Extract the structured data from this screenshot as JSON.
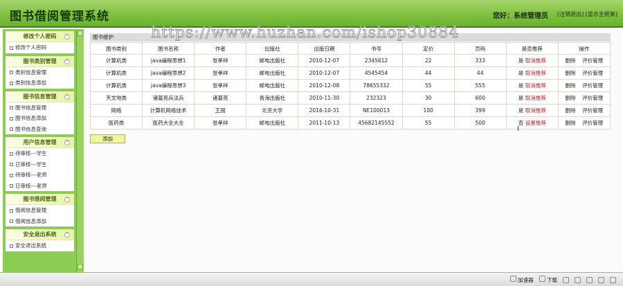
{
  "header": {
    "title": "图书借阅管理系统",
    "greeting": "您好：系统管理员",
    "logout": "[注销退出]",
    "show_frame": "[显示主框架]"
  },
  "sidebar": [
    {
      "title": "修改个人密码",
      "items": [
        "修改个人密码"
      ]
    },
    {
      "title": "图书类别管理",
      "items": [
        "类别信息管理",
        "类别信息添加"
      ]
    },
    {
      "title": "图书信息管理",
      "items": [
        "图书信息管理",
        "图书信息添加",
        "图书信息查询"
      ]
    },
    {
      "title": "用户信息管理",
      "items": [
        "待审核---学生",
        "已审核---学生",
        "待审核---老师",
        "已审核---老师"
      ]
    },
    {
      "title": "图书借阅管理",
      "items": [
        "借阅信息管理",
        "借阅信息添加"
      ]
    },
    {
      "title": "安全退出系统",
      "items": [
        "安全退出系统"
      ]
    }
  ],
  "main": {
    "panel_title": "图书维护",
    "columns": [
      "图书类别",
      "图书名称",
      "作者",
      "出版社",
      "出版日期",
      "书号",
      "定价",
      "页码",
      "是否推荐",
      "操作"
    ],
    "rows": [
      {
        "cat": "计算机类",
        "name": "java编程思想1",
        "author": "张孝祥",
        "pub": "邮电出版社",
        "date": "2010-12-07",
        "isbn": "2345612",
        "price": "22",
        "pages": "333",
        "rec": "是",
        "rec_action": "取消推荐",
        "del": "删除",
        "review": "评价管理"
      },
      {
        "cat": "计算机类",
        "name": "java编程思想2",
        "author": "张孝祥",
        "pub": "邮电出版社",
        "date": "2010-12-07",
        "isbn": "4545454",
        "price": "44",
        "pages": "44",
        "rec": "是",
        "rec_action": "取消推荐",
        "del": "删除",
        "review": "评价管理"
      },
      {
        "cat": "计算机类",
        "name": "java编程思想3",
        "author": "张孝祥",
        "pub": "邮电出版社",
        "date": "2010-12-08",
        "isbn": "78655332",
        "price": "55",
        "pages": "555",
        "rec": "是",
        "rec_action": "取消推荐",
        "del": "删除",
        "review": "评价管理"
      },
      {
        "cat": "天文地类",
        "name": "诸葛亮兵法兵",
        "author": "诸葛亮",
        "pub": "青海出版社",
        "date": "2010-11-30",
        "isbn": "232323",
        "price": "30",
        "pages": "600",
        "rec": "是",
        "rec_action": "取消推荐",
        "del": "删除",
        "review": "评价管理"
      },
      {
        "cat": "网络",
        "name": "计算机网络技术",
        "author": "王国",
        "pub": "北京大学",
        "date": "2016-10-31",
        "isbn": "NE100013",
        "price": "100",
        "pages": "399",
        "rec": "是",
        "rec_action": "取消推荐",
        "del": "删除",
        "review": "评价管理"
      },
      {
        "cat": "医药类",
        "name": "医药大全大全",
        "author": "张孝祥",
        "pub": "邮电出版社",
        "date": "2011-10-13",
        "isbn": "45682145552",
        "price": "55",
        "pages": "500",
        "rec": "否",
        "rec_action": "设置推荐",
        "del": "删除",
        "review": "评价管理"
      }
    ],
    "add_label": "添加"
  },
  "watermark": "https://www.huzhan.com/ishop30884",
  "statusbar": {
    "accelerator": "加速器",
    "download": "下载"
  }
}
